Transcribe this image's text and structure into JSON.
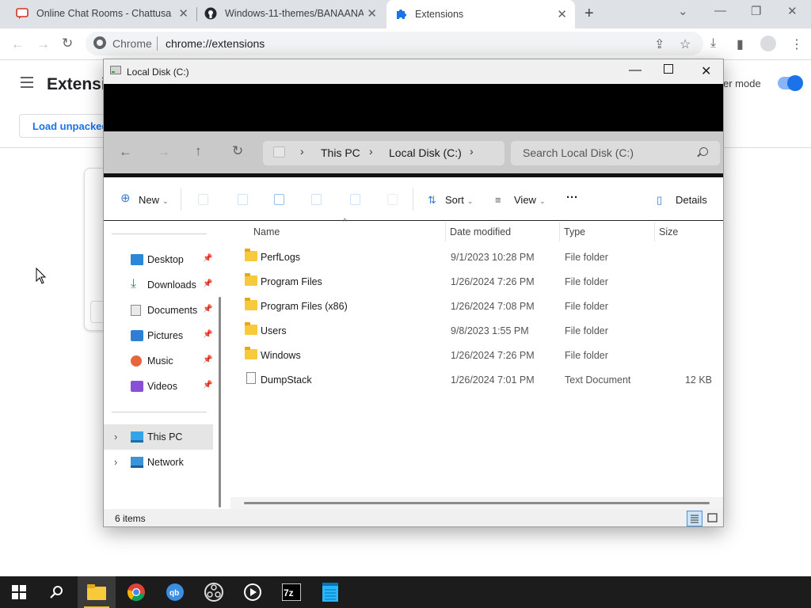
{
  "browser": {
    "tabs": [
      {
        "title": "Online Chat Rooms - Chattusa",
        "active": false
      },
      {
        "title": "Windows-11-themes/BANAANA/",
        "active": false
      },
      {
        "title": "Extensions",
        "active": true
      }
    ],
    "omnibox": {
      "site": "Chrome",
      "url": "chrome://extensions"
    }
  },
  "extensions_page": {
    "title": "Extensions",
    "dev_mode_label": "er mode",
    "load_unpacked": "Load unpacked"
  },
  "explorer": {
    "window_title": "Local Disk (C:)",
    "breadcrumb": [
      "This PC",
      "Local Disk (C:)"
    ],
    "search_placeholder": "Search Local Disk (C:)",
    "commands": {
      "new": "New",
      "sort": "Sort",
      "view": "View",
      "more": "···",
      "details": "Details"
    },
    "nav_items": [
      {
        "label": "Desktop",
        "icon": "desktop-icon",
        "pinned": true
      },
      {
        "label": "Downloads",
        "icon": "downloads-icon",
        "pinned": true
      },
      {
        "label": "Documents",
        "icon": "documents-icon",
        "pinned": true
      },
      {
        "label": "Pictures",
        "icon": "pictures-icon",
        "pinned": true
      },
      {
        "label": "Music",
        "icon": "music-icon",
        "pinned": true
      },
      {
        "label": "Videos",
        "icon": "videos-icon",
        "pinned": true
      }
    ],
    "tree_items": [
      {
        "label": "This PC",
        "icon": "this-pc-icon",
        "selected": true
      },
      {
        "label": "Network",
        "icon": "network-icon",
        "selected": false
      }
    ],
    "columns": [
      "Name",
      "Date modified",
      "Type",
      "Size"
    ],
    "rows": [
      {
        "name": "PerfLogs",
        "date": "9/1/2023 10:28 PM",
        "type": "File folder",
        "size": "",
        "icon": "folder-icon"
      },
      {
        "name": "Program Files",
        "date": "1/26/2024 7:26 PM",
        "type": "File folder",
        "size": "",
        "icon": "folder-icon"
      },
      {
        "name": "Program Files (x86)",
        "date": "1/26/2024 7:08 PM",
        "type": "File folder",
        "size": "",
        "icon": "folder-icon"
      },
      {
        "name": "Users",
        "date": "9/8/2023 1:55 PM",
        "type": "File folder",
        "size": "",
        "icon": "folder-icon"
      },
      {
        "name": "Windows",
        "date": "1/26/2024 7:26 PM",
        "type": "File folder",
        "size": "",
        "icon": "folder-icon"
      },
      {
        "name": "DumpStack",
        "date": "1/26/2024 7:01 PM",
        "type": "Text Document",
        "size": "12 KB",
        "icon": "text-document-icon"
      }
    ],
    "status": "6 items"
  },
  "taskbar": {
    "apps": [
      "start-icon",
      "search-icon",
      "file-explorer-icon",
      "chrome-icon",
      "qbittorrent-icon",
      "obs-icon",
      "media-player-icon",
      "7zip-icon",
      "notepad-icon"
    ]
  },
  "colors": {
    "accent": "#1a73e8",
    "folder": "#f8c93b",
    "taskbar": "#1c1c1c"
  }
}
